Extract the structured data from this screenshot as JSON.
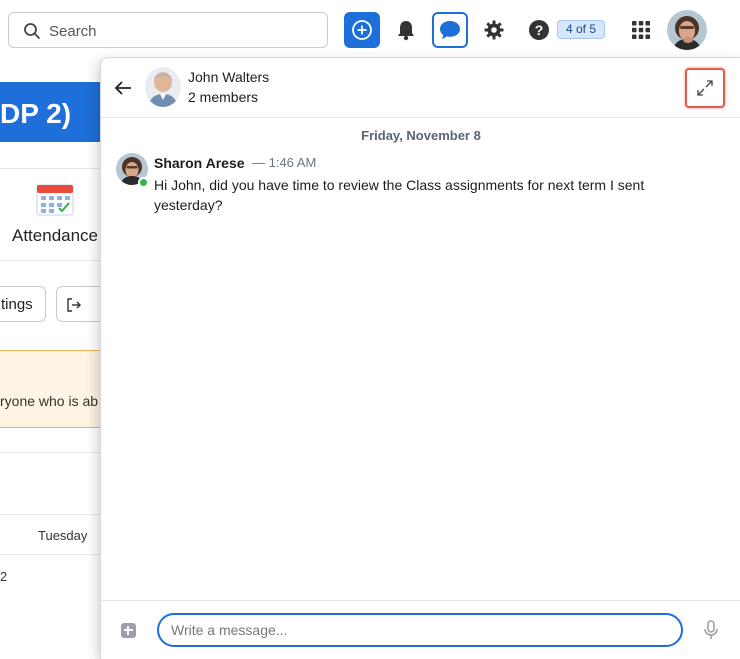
{
  "topbar": {
    "search_placeholder": "Search",
    "pagination_badge": "4 of 5",
    "icons": [
      "add-icon",
      "bell-icon",
      "chat-icon",
      "gear-icon",
      "help-icon",
      "apps-grid-icon"
    ]
  },
  "background": {
    "banner_text": "DP 2)",
    "attendance_label": "Attendance",
    "button_partial": "tings",
    "warning_partial": "ryone who is ab",
    "column_header": "Tuesday",
    "cell_value": "2"
  },
  "chat": {
    "contact_name": "John Walters",
    "member_count": "2 members",
    "date_separator": "Friday, November 8",
    "messages": [
      {
        "author": "Sharon Arese",
        "time": "— 1:46 AM",
        "text": "Hi John, did you have time to review the Class assignments for next term I sent yesterday?"
      }
    ],
    "composer_placeholder": "Write a message..."
  },
  "colors": {
    "accent": "#1e6fd9",
    "highlight": "#e35a4f",
    "online": "#2fb54b",
    "warning_bg": "#fdf4e3"
  }
}
